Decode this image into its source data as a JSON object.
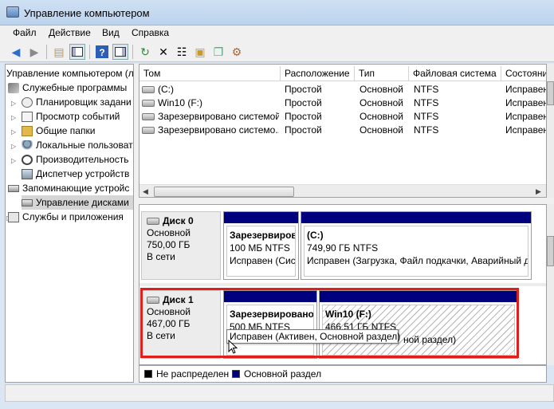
{
  "window": {
    "title": "Управление компьютером"
  },
  "menu": [
    "Файл",
    "Действие",
    "Вид",
    "Справка"
  ],
  "toolbar": [
    "back-icon",
    "forward-icon",
    "up-folder-icon",
    "console-tree-icon",
    "help-icon",
    "show-hide-icon",
    "refresh-icon",
    "delete-icon",
    "properties-icon",
    "open-icon",
    "export-icon"
  ],
  "tree": {
    "root": "Управление компьютером (л",
    "items": [
      "Служебные программы",
      "Планировщик задани",
      "Просмотр событий",
      "Общие папки",
      "Локальные пользоват",
      "Производительность",
      "Диспетчер устройств",
      "Запоминающие устройс",
      "Управление дисками",
      "Службы и приложения"
    ]
  },
  "volumes": {
    "columns": [
      "Том",
      "Расположение",
      "Тип",
      "Файловая система",
      "Состояние"
    ],
    "rows": [
      [
        "(C:)",
        "Простой",
        "Основной",
        "NTFS",
        "Исправен"
      ],
      [
        "Win10 (F:)",
        "Простой",
        "Основной",
        "NTFS",
        "Исправен"
      ],
      [
        "Зарезервировано системой",
        "Простой",
        "Основной",
        "NTFS",
        "Исправен"
      ],
      [
        "Зарезервировано системо...",
        "Простой",
        "Основной",
        "NTFS",
        "Исправен"
      ]
    ]
  },
  "disks": [
    {
      "name": "Диск 0",
      "type": "Основной",
      "size": "750,00 ГБ",
      "status": "В сети",
      "partitions": [
        {
          "name": "Зарезервиров",
          "size": "100 МБ NTFS",
          "status": "Исправен (Сис"
        },
        {
          "name": "(C:)",
          "size": "749,90 ГБ NTFS",
          "status": "Исправен (Загрузка, Файл подкачки, Аварийный д"
        }
      ]
    },
    {
      "name": "Диск 1",
      "type": "Основной",
      "size": "467,00 ГБ",
      "status": "В сети",
      "partitions": [
        {
          "name": "Зарезервировано",
          "size": "500 МБ NTFS",
          "status": "Исправен (Активен, Основной раздел)"
        },
        {
          "name": "Win10  (F:)",
          "size": "466,51 ГБ NTFS",
          "status": "ной раздел)"
        }
      ]
    }
  ],
  "tooltip": "Исправен (Активен, Основной раздел)",
  "legend": [
    {
      "label": "Не распределен",
      "color": "#000000"
    },
    {
      "label": "Основной раздел",
      "color": "#00007f"
    }
  ],
  "colors": {
    "primary_partition": "#00007f",
    "highlight_box": "#e01e1e"
  }
}
